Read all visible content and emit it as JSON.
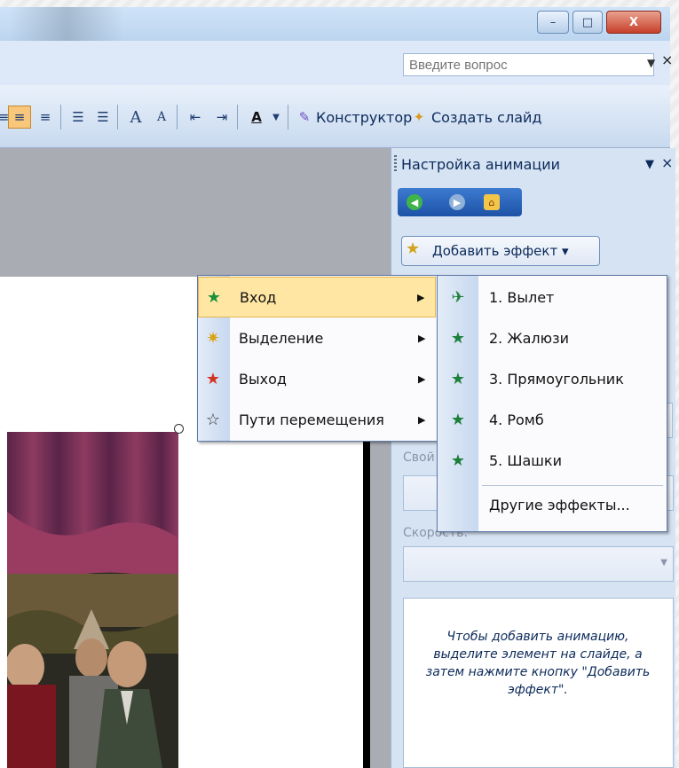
{
  "window": {
    "minimize_glyph": "–",
    "restore_glyph": "□",
    "close_glyph": "X"
  },
  "help": {
    "placeholder": "Введите вопрос",
    "close_glyph": "×"
  },
  "toolbar": {
    "designer_label": "Конструктор",
    "new_slide_label": "Создать слайд",
    "font_color_letter": "A",
    "grow_font_letter": "A",
    "shrink_font_letter": "A"
  },
  "task_pane": {
    "title": "Настройка анимации",
    "close_glyph": "×",
    "add_effect_label": "Добавить эффект ▾",
    "property_label": "Свой",
    "speed_label": "Скорость:",
    "info_text": "Чтобы добавить анимацию, выделите элемент на слайде, а затем нажмите кнопку \"Добавить эффект\"."
  },
  "effect_menu": {
    "items": [
      {
        "label": "Вход",
        "icon": "star-green-icon",
        "highlighted": true
      },
      {
        "label": "Выделение",
        "icon": "star-yellow-icon",
        "highlighted": false
      },
      {
        "label": "Выход",
        "icon": "star-red-icon",
        "highlighted": false
      },
      {
        "label": "Пути перемещения",
        "icon": "star-outline-icon",
        "highlighted": false
      }
    ]
  },
  "entry_submenu": {
    "items": [
      {
        "label": "1. Вылет"
      },
      {
        "label": "2. Жалюзи"
      },
      {
        "label": "3. Прямоугольник"
      },
      {
        "label": "4. Ромб"
      },
      {
        "label": "5. Шашки"
      }
    ],
    "more_label": "Другие эффекты..."
  },
  "colors": {
    "highlight": "#ffe7a3",
    "accent": "#1d52a6"
  }
}
